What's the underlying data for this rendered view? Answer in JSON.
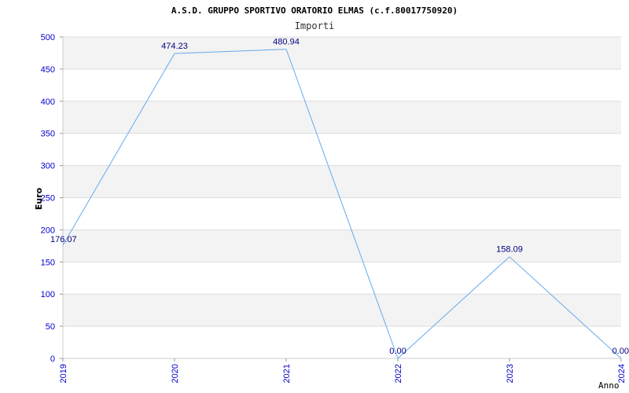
{
  "chart_data": {
    "type": "line",
    "title": "A.S.D. GRUPPO SPORTIVO ORATORIO ELMAS (c.f.80017750920)",
    "subtitle": "Importi",
    "xlabel": "Anno",
    "ylabel": "Euro",
    "categories": [
      "2019",
      "2020",
      "2021",
      "2022",
      "2023",
      "2024"
    ],
    "series": [
      {
        "values": [
          176.07,
          474.23,
          480.94,
          0.0,
          158.09,
          0.0
        ]
      }
    ],
    "data_labels": [
      "176.07",
      "474.23",
      "480.94",
      "0.00",
      "158.09",
      "0.00"
    ],
    "ylim": [
      0,
      500
    ],
    "yticks": [
      0,
      50,
      100,
      150,
      200,
      250,
      300,
      350,
      400,
      450,
      500
    ],
    "grid": true,
    "colors": {
      "line": "#66aaee",
      "band": "#f3f3f3",
      "gridline": "#dddddd",
      "tick": "#0000cc",
      "label": "#000080"
    }
  }
}
